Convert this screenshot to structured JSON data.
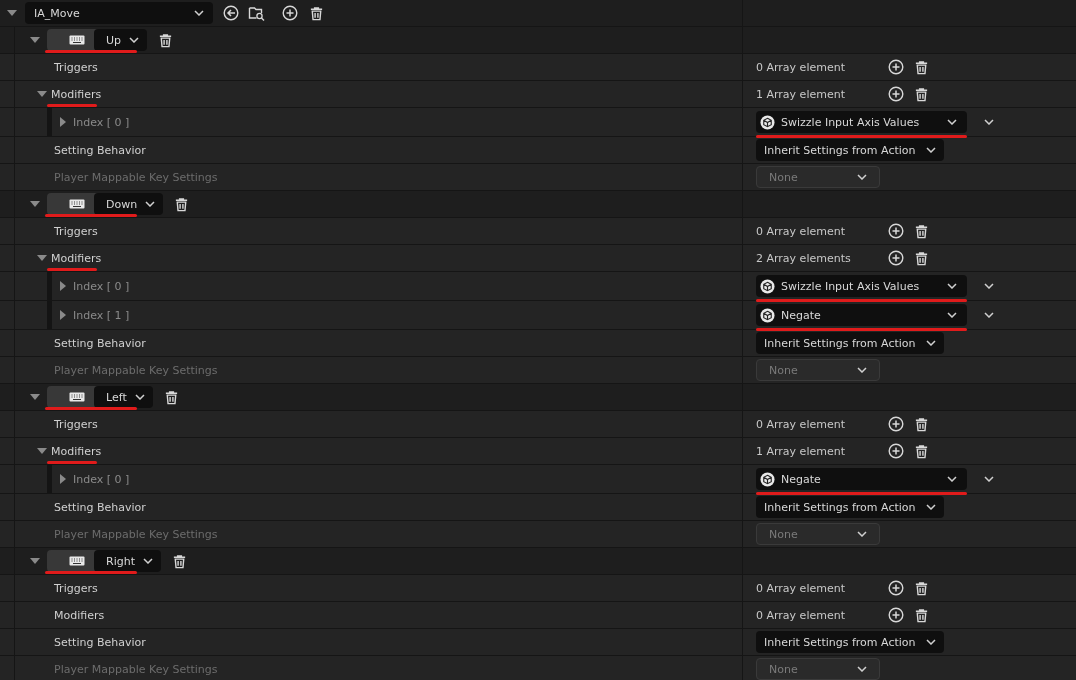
{
  "action": {
    "name": "IA_Move",
    "expanded": true
  },
  "mappings": [
    {
      "key": "Up",
      "expanded": true,
      "marked": true,
      "rows": [
        {
          "kind": "array",
          "label": "Triggers",
          "count": "0 Array element"
        },
        {
          "kind": "array",
          "label": "Modifiers",
          "count": "1 Array element",
          "expanded": true,
          "marked": true,
          "children": [
            {
              "label": "Index [ 0 ]",
              "value": "Swizzle Input Axis Values",
              "expanded": false,
              "marked": true
            }
          ]
        },
        {
          "kind": "dropdown",
          "label": "Setting Behavior",
          "value": "Inherit Settings from Action",
          "disabled": false
        },
        {
          "kind": "dropdown",
          "label": "Player Mappable Key Settings",
          "value": "None",
          "disabled": true
        }
      ]
    },
    {
      "key": "Down",
      "expanded": true,
      "marked": true,
      "rows": [
        {
          "kind": "array",
          "label": "Triggers",
          "count": "0 Array element"
        },
        {
          "kind": "array",
          "label": "Modifiers",
          "count": "2 Array elements",
          "expanded": true,
          "marked": true,
          "children": [
            {
              "label": "Index [ 0 ]",
              "value": "Swizzle Input Axis Values",
              "expanded": false,
              "marked": true
            },
            {
              "label": "Index [ 1 ]",
              "value": "Negate",
              "expanded": false,
              "marked": true
            }
          ]
        },
        {
          "kind": "dropdown",
          "label": "Setting Behavior",
          "value": "Inherit Settings from Action",
          "disabled": false
        },
        {
          "kind": "dropdown",
          "label": "Player Mappable Key Settings",
          "value": "None",
          "disabled": true
        }
      ]
    },
    {
      "key": "Left",
      "expanded": true,
      "marked": true,
      "rows": [
        {
          "kind": "array",
          "label": "Triggers",
          "count": "0 Array element"
        },
        {
          "kind": "array",
          "label": "Modifiers",
          "count": "1 Array element",
          "expanded": true,
          "marked": true,
          "children": [
            {
              "label": "Index [ 0 ]",
              "value": "Negate",
              "expanded": false,
              "marked": true
            }
          ]
        },
        {
          "kind": "dropdown",
          "label": "Setting Behavior",
          "value": "Inherit Settings from Action",
          "disabled": false
        },
        {
          "kind": "dropdown",
          "label": "Player Mappable Key Settings",
          "value": "None",
          "disabled": true
        }
      ]
    },
    {
      "key": "Right",
      "expanded": true,
      "marked": true,
      "rows": [
        {
          "kind": "array",
          "label": "Triggers",
          "count": "0 Array element"
        },
        {
          "kind": "array",
          "label": "Modifiers",
          "count": "0 Array element"
        },
        {
          "kind": "dropdown",
          "label": "Setting Behavior",
          "value": "Inherit Settings from Action",
          "disabled": false
        },
        {
          "kind": "dropdown",
          "label": "Player Mappable Key Settings",
          "value": "None",
          "disabled": true
        }
      ]
    }
  ]
}
